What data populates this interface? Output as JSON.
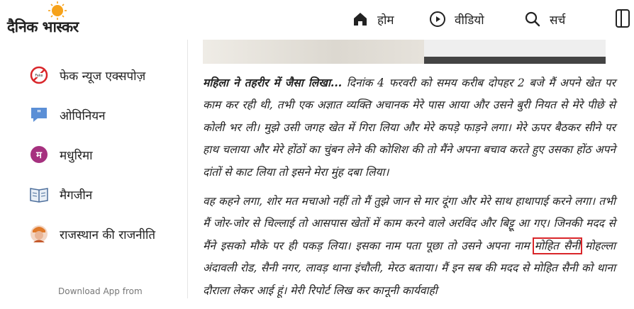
{
  "header": {
    "logo_text": "दैनिक भास्कर",
    "nav": [
      {
        "label": "होम",
        "icon": "home-icon"
      },
      {
        "label": "वीडियो",
        "icon": "play-icon"
      },
      {
        "label": "सर्च",
        "icon": "search-icon"
      }
    ]
  },
  "sidebar": {
    "items": [
      {
        "label": "फेक न्यूज एक्सपोज़",
        "icon": "fake-news-icon"
      },
      {
        "label": "ओपिनियन",
        "icon": "quote-bubble-icon"
      },
      {
        "label": "मधुरिमा",
        "icon": "madhurima-icon"
      },
      {
        "label": "मैगजीन",
        "icon": "magazine-icon"
      },
      {
        "label": "राजस्थान की राजनीति",
        "icon": "rajasthan-politics-icon"
      }
    ],
    "download_text": "Download App from"
  },
  "article": {
    "para1_lead": "महिला ने तहरीर में जैसा लिखा...",
    "para1_body": " दिनांक 4 फरवरी को समय करीब दोपहर 2 बजे मैं अपने खेत पर काम कर रही थी, तभी एक अज्ञात व्यक्ति अचानक मेरे पास आया और उसने बुरी नियत से मेरे पीछे से कोली भर ली। मुझे उसी जगह खेत में गिरा लिया और मेरे कपड़े फाड़ने लगा। मेरे ऊपर बैठकर सीने पर हाथ चलाया और मेरे होंठों का चुंबन लेने की कोशिश की तो मैंने अपना बचाव करते हुए उसका होंठ अपने दांतों से काट लिया तो इसने मेरा मुंह दबा लिया।",
    "para2_before": "वह कहने लगा, शोर मत मचाओ नहीं तो मैं तुझे जान से मार दूंगा और मेरे साथ हाथापाई करने लगा। तभी मैं जोर-जोर से चिल्लाई तो आसपास खेतों में काम करने वाले अरविंद और बिट्टू आ गए। जिनकी मदद से मैंने इसको मौके पर ही पकड़ लिया। इसका नाम पता पूछा तो उसने अपना नाम ",
    "para2_highlight": "मोहित सैनी",
    "para2_after": " मोहल्ला अंदावली रोड, सैनी नगर, लावड़ थाना इंचौली, मेरठ बताया। मैं इन सब की मदद से मोहित सैनी को थाना दौराला लेकर आई हूं। मेरी रिपोर्ट लिख कर कानूनी कार्यवाही"
  },
  "colors": {
    "highlight_border": "#d9262a",
    "logo_sun": "#f6a21a"
  }
}
